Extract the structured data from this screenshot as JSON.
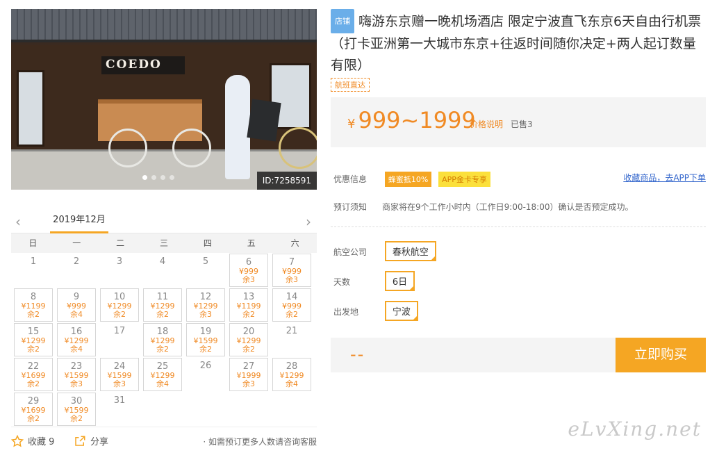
{
  "photo": {
    "shop_sign": "COEDO",
    "id_label": "ID:7258591",
    "dots": 4,
    "active_dot": 1
  },
  "calendar": {
    "month": "2019年12月",
    "prev_icon": "chevron-left-icon",
    "next_icon": "chevron-right-icon",
    "weekdays": [
      "日",
      "一",
      "二",
      "三",
      "四",
      "五",
      "六"
    ],
    "days": [
      {
        "d": "1"
      },
      {
        "d": "2"
      },
      {
        "d": "3"
      },
      {
        "d": "4"
      },
      {
        "d": "5"
      },
      {
        "d": "6",
        "p": "¥999",
        "r": "余3"
      },
      {
        "d": "7",
        "p": "¥999",
        "r": "余3"
      },
      {
        "d": "8",
        "p": "¥1199",
        "r": "余2"
      },
      {
        "d": "9",
        "p": "¥999",
        "r": "余4"
      },
      {
        "d": "10",
        "p": "¥1299",
        "r": "余2"
      },
      {
        "d": "11",
        "p": "¥1299",
        "r": "余2"
      },
      {
        "d": "12",
        "p": "¥1299",
        "r": "余3"
      },
      {
        "d": "13",
        "p": "¥1199",
        "r": "余2"
      },
      {
        "d": "14",
        "p": "¥999",
        "r": "余2"
      },
      {
        "d": "15",
        "p": "¥1299",
        "r": "余2"
      },
      {
        "d": "16",
        "p": "¥1299",
        "r": "余4"
      },
      {
        "d": "17"
      },
      {
        "d": "18",
        "p": "¥1299",
        "r": "余2"
      },
      {
        "d": "19",
        "p": "¥1599",
        "r": "余2"
      },
      {
        "d": "20",
        "p": "¥1299",
        "r": "余2"
      },
      {
        "d": "21"
      },
      {
        "d": "22",
        "p": "¥1699",
        "r": "余2"
      },
      {
        "d": "23",
        "p": "¥1599",
        "r": "余3"
      },
      {
        "d": "24",
        "p": "¥1599",
        "r": "余3"
      },
      {
        "d": "25",
        "p": "¥1299",
        "r": "余4"
      },
      {
        "d": "26"
      },
      {
        "d": "27",
        "p": "¥1999",
        "r": "余3"
      },
      {
        "d": "28",
        "p": "¥1299",
        "r": "余4"
      },
      {
        "d": "29",
        "p": "¥1699",
        "r": "余2"
      },
      {
        "d": "30",
        "p": "¥1599",
        "r": "余2"
      },
      {
        "d": "31"
      }
    ]
  },
  "footer": {
    "fav_label": "收藏 9",
    "fav_icon": "star-outline-icon",
    "share_label": "分享",
    "share_icon": "share-icon",
    "note": "· 如需预订更多人数请咨询客服"
  },
  "product": {
    "store_tag": "店铺",
    "title": "嗨游东京赠一晚机场酒店 限定宁波直飞东京6天自由行机票（打卡亚洲第一大城市东京+往返时间随你决定+两人起订数量有限）",
    "flight_tag": "航班直达",
    "price_yen": "¥",
    "price": "999~1999",
    "price_note": "价格说明",
    "sold": "已售3"
  },
  "promo": {
    "label": "优惠信息",
    "badge1": "蜂蜜抵10%",
    "badge2": "APP金卡专享",
    "app_link": "收藏商品，去APP下单"
  },
  "booking": {
    "label": "预订须知",
    "text": "商家将在9个工作小时内（工作日9:00-18:00）确认是否预定成功。"
  },
  "options": {
    "airline_label": "航空公司",
    "airline_value": "春秋航空",
    "days_label": "天数",
    "days_value": "6日",
    "origin_label": "出发地",
    "origin_value": "宁波"
  },
  "buy": {
    "qty": "--",
    "button": "立即购买"
  },
  "watermark": "eLvXing.net",
  "colors": {
    "accent": "#f5a623",
    "price": "#f08a24",
    "link": "#3366cc",
    "store_tag": "#6aaee9"
  }
}
